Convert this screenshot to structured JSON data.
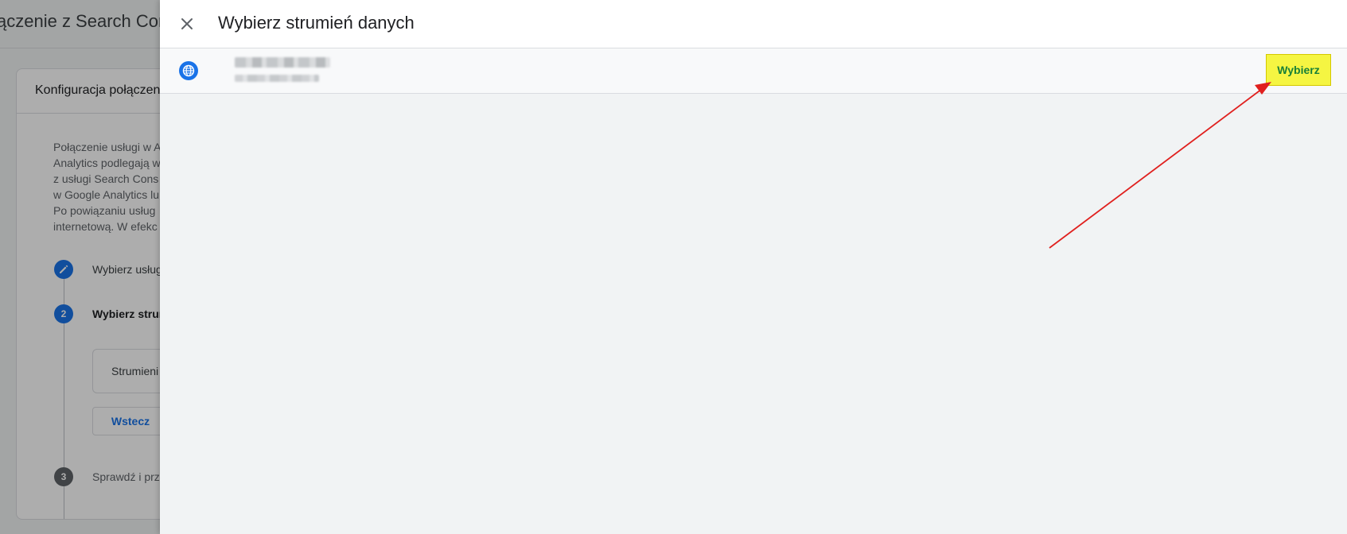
{
  "background_page": {
    "title": "ączenie z Search Con",
    "card_title": "Konfiguracja połączen",
    "description_lines": [
      "Połączenie usługi w A",
      "Analytics podlegają w",
      "z usługi Search Cons",
      "w Google Analytics lu",
      "Po powiązaniu usług",
      "internetową. W efekc"
    ],
    "steps": [
      {
        "number": "",
        "label": "Wybierz usług"
      },
      {
        "number": "2",
        "label": "Wybierz strum"
      },
      {
        "number": "3",
        "label": "Sprawdź i prz"
      }
    ],
    "stream_box_label": "Strumieni",
    "back_button_label": "Wstecz"
  },
  "panel": {
    "title": "Wybierz strumień danych",
    "close_icon": "close-icon",
    "streams": [
      {
        "icon": "globe-icon",
        "name": "████ ████ ████",
        "url": "██████████████",
        "select_label": "Wybierz"
      }
    ]
  },
  "colors": {
    "accent": "#1a73e8",
    "highlight": "#f5f542",
    "select_text": "#188038",
    "arrow": "#e0201e"
  }
}
